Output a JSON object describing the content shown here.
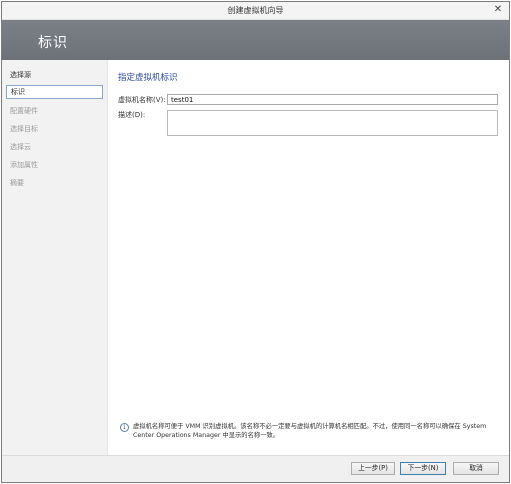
{
  "window": {
    "title": "创建虚拟机向导",
    "close_glyph": "✕"
  },
  "banner": {
    "title": "标识"
  },
  "sidebar": {
    "items": [
      {
        "label": "选择源",
        "state": "normal"
      },
      {
        "label": "标识",
        "state": "active"
      },
      {
        "label": "配置硬件",
        "state": "disabled"
      },
      {
        "label": "选择目标",
        "state": "disabled"
      },
      {
        "label": "选择云",
        "state": "disabled"
      },
      {
        "label": "添加属性",
        "state": "disabled"
      },
      {
        "label": "摘要",
        "state": "disabled"
      }
    ]
  },
  "main": {
    "section_title": "指定虚拟机标识",
    "name_label": "虚拟机名称(V):",
    "name_value": "test01",
    "description_label": "描述(D):",
    "description_value": ""
  },
  "info": {
    "icon": "info-icon",
    "text": "虚拟机名称可便于 VMM 识别虚拟机。该名称不必一定要与虚拟机的计算机名相匹配。不过，使用同一名称可以确保在 System Center Operations Manager 中显示的名称一致。"
  },
  "footer": {
    "prev_label": "上一步(P)",
    "next_label": "下一步(N)",
    "cancel_label": "取消"
  },
  "colors": {
    "banner": "#6f737a",
    "section_title": "#27469f",
    "active_border": "#8aa6c9"
  }
}
